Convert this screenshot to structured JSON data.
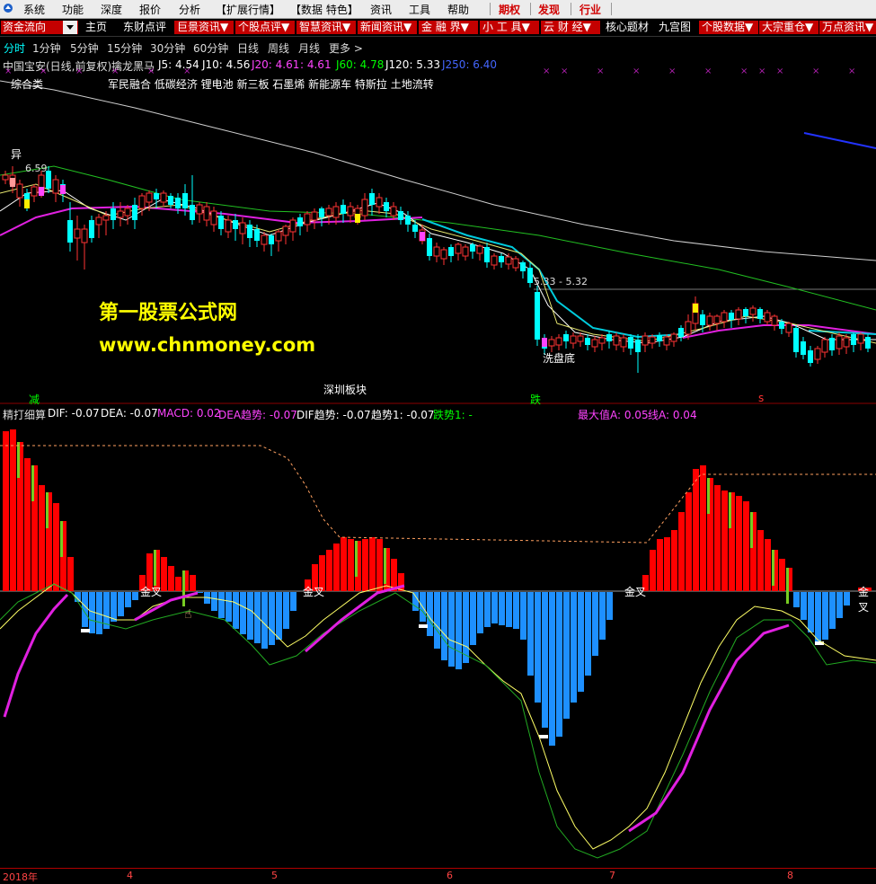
{
  "menu": {
    "items": [
      "系统",
      "功能",
      "深度",
      "报价",
      "分析",
      "【扩展行情】",
      "【数据 特色】",
      "资讯",
      "工具",
      "帮助"
    ],
    "hot_items": [
      "期权",
      "发现",
      "行业"
    ]
  },
  "toolbar": {
    "dropdown_label": "资金流向",
    "items": [
      {
        "label": "主页",
        "style": "plain"
      },
      {
        "label": "东财点评",
        "style": "plain"
      },
      {
        "label": "巨景资讯▼",
        "style": "red"
      },
      {
        "label": "个股点评▼",
        "style": "red"
      },
      {
        "label": "智慧资讯▼",
        "style": "red"
      },
      {
        "label": "新闻资讯▼",
        "style": "red"
      },
      {
        "label": "金 融 界▼",
        "style": "red"
      },
      {
        "label": "小 工 具▼",
        "style": "red"
      },
      {
        "label": "云 财 经▼",
        "style": "red"
      },
      {
        "label": "核心题材",
        "style": "plain"
      },
      {
        "label": "九宫图",
        "style": "plain"
      },
      {
        "label": "个股数据▼",
        "style": "red"
      },
      {
        "label": "大宗重仓▼",
        "style": "red"
      },
      {
        "label": "万点资讯▼",
        "style": "red"
      }
    ]
  },
  "periods": [
    "分时",
    "1分钟",
    "5分钟",
    "15分钟",
    "30分钟",
    "60分钟",
    "日线",
    "周线",
    "月线",
    "更多 >"
  ],
  "active_period": "分时",
  "upper_title": {
    "stock": "中国宝安(日线,前复权)",
    "indicator": "擒龙黑马",
    "values": [
      {
        "label": "J5: 4.54",
        "color": "#ffffff"
      },
      {
        "label": "J10: 4.56",
        "color": "#ffffff"
      },
      {
        "label": "J20: 4.61",
        "color": "#ff44ff"
      },
      {
        "label": ": 4.61",
        "color": "#ff44ff"
      },
      {
        "label": "J60: 4.78",
        "color": "#00ff00"
      },
      {
        "label": "J120: 5.33",
        "color": "#ffffff"
      },
      {
        "label": "J250: 6.40",
        "color": "#4444ff"
      }
    ]
  },
  "concepts": {
    "category": "综合类",
    "tags": "军民融合 低碳经济 锂电池 新三板 石墨烯 新能源车 特斯拉 土地流转"
  },
  "upper_labels": {
    "yi": "异",
    "high_price": "6.59",
    "range": "5.33 - 5.32",
    "xipandi": "洗盘底",
    "jian": "减",
    "sector": "深圳板块",
    "die": "跌",
    "s_mark": "s"
  },
  "watermark": {
    "line1": "第一股票公式网",
    "line2": "www.chnmoney.com"
  },
  "lower_title": {
    "name": "精打细算",
    "values": [
      {
        "label": "DIF: -0.07",
        "color": "#ffffff"
      },
      {
        "label": "DEA: -0.07",
        "color": "#ffffff"
      },
      {
        "label": "MACD: 0.02",
        "color": "#ff44ff"
      },
      {
        "label": "DEA趋势: -0.07",
        "color": "#ff44ff"
      },
      {
        "label": "DIF趋势: -0.07",
        "color": "#ffffff"
      },
      {
        "label": "趋势1: -0.07",
        "color": "#ffffff"
      },
      {
        "label": "跌势1: -",
        "color": "#00ff00"
      },
      {
        "label": "最大值A: 0.05",
        "color": "#ff44ff"
      },
      {
        "label": "线A: 0.04",
        "color": "#ff44ff"
      }
    ]
  },
  "golden_cross_label": "金叉",
  "x_axis": [
    "2018年",
    "4",
    "5",
    "6",
    "7",
    "8"
  ],
  "colors": {
    "up": "#ff3333",
    "down": "#00ffff",
    "macd_red": "#ff0000",
    "macd_blue": "#1e90ff",
    "bg": "#000000"
  }
}
